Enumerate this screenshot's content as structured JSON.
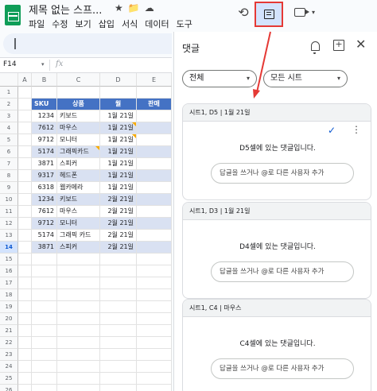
{
  "app": {
    "title": "제목 없는 스프...",
    "menu": [
      "파일",
      "수정",
      "보기",
      "삽입",
      "서식",
      "데이터",
      "도구"
    ]
  },
  "icons": {
    "title_icons": [
      "★",
      "📁",
      "☁"
    ],
    "history": "⟲",
    "more_vert": "⋮",
    "close": "✕",
    "check": "✓",
    "caret": "▾"
  },
  "formula": {
    "namebox": "F14",
    "fx": "fx"
  },
  "grid": {
    "columns": [
      "A",
      "B",
      "C",
      "D",
      "E"
    ],
    "row_numbers": [
      "1",
      "2",
      "3",
      "4",
      "5",
      "6",
      "7",
      "8",
      "9",
      "10",
      "11",
      "12",
      "13",
      "14",
      "15",
      "16",
      "17",
      "18",
      "19",
      "20",
      "21",
      "22",
      "23",
      "24",
      "25",
      "26"
    ],
    "selected_row": "14",
    "header": [
      "SKU",
      "상품",
      "월",
      "판매"
    ],
    "rows": [
      [
        "1234",
        "키보드",
        "1월 21일"
      ],
      [
        "7612",
        "마우스",
        "1월 21일"
      ],
      [
        "9712",
        "모니터",
        "1월 21일"
      ],
      [
        "5174",
        "그래픽카드",
        "1월 21일"
      ],
      [
        "3871",
        "스피커",
        "1월 21일"
      ],
      [
        "9317",
        "헤드폰",
        "1월 21일"
      ],
      [
        "6318",
        "웹카메라",
        "1월 21일"
      ],
      [
        "1234",
        "키보드",
        "2월 21일"
      ],
      [
        "7612",
        "마우스",
        "2월 21일"
      ],
      [
        "9712",
        "모니터",
        "2월 21일"
      ],
      [
        "5174",
        "그래픽 카드",
        "2월 21일"
      ],
      [
        "3871",
        "스피커",
        "2월 21일"
      ]
    ]
  },
  "panel": {
    "title": "댓글",
    "filter_all": "전체",
    "filter_sheets": "모든 시트",
    "reply_placeholder": "답글을 쓰거나 @로 다른 사용자 추가",
    "threads": [
      {
        "ref": "시트1, D5 | 1월 21일",
        "text": "D5셀에 있는 댓글입니다."
      },
      {
        "ref": "시트1, D3 | 1월 21일",
        "text": "D4셀에 있는 댓글입니다."
      },
      {
        "ref": "시트1, C4 | 마우스",
        "text": "C4셀에 있는 댓글입니다."
      }
    ]
  },
  "colors": {
    "header_fill": "#4472c4",
    "band_fill": "#d9e1f2",
    "highlight": "#e53935",
    "accent": "#0b57d0"
  }
}
